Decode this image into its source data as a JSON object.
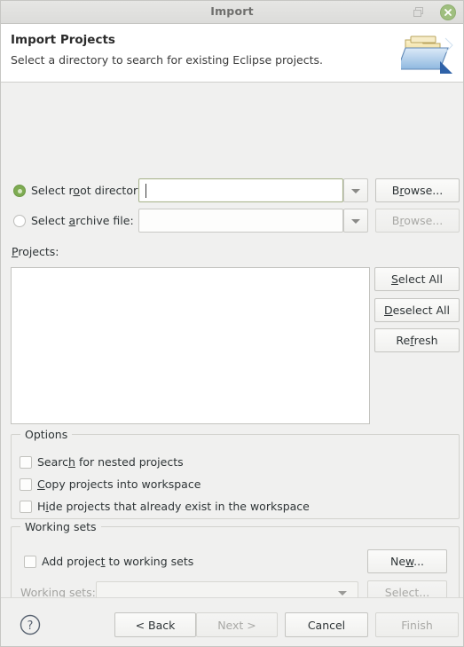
{
  "window": {
    "title": "Import",
    "restore_icon": "restore-icon",
    "close_icon": "close-icon"
  },
  "header": {
    "title": "Import Projects",
    "description": "Select a directory to search for existing Eclipse projects.",
    "icon": "open-folder-icon"
  },
  "source": {
    "root_directory": {
      "label_pre": "Select r",
      "label_mn": "o",
      "label_post": "ot directory:",
      "selected": true,
      "value": "",
      "dropdown_icon": "chevron-down-icon",
      "browse": {
        "pre": "B",
        "mn": "r",
        "post": "owse...",
        "enabled": true
      }
    },
    "archive_file": {
      "label_pre": "Select ",
      "label_mn": "a",
      "label_post": "rchive file:",
      "selected": false,
      "value": "",
      "dropdown_icon": "chevron-down-icon",
      "browse": {
        "pre": "B",
        "mn": "r",
        "post": "owse...",
        "enabled": false
      }
    }
  },
  "projects": {
    "label_pre": "",
    "label_mn": "P",
    "label_post": "rojects:",
    "items": [],
    "buttons": [
      {
        "pre": "",
        "mn": "S",
        "post": "elect All",
        "enabled": true,
        "name": "select-all-button"
      },
      {
        "pre": "",
        "mn": "D",
        "post": "eselect All",
        "enabled": true,
        "name": "deselect-all-button"
      },
      {
        "pre": "Re",
        "mn": "f",
        "post": "resh",
        "enabled": true,
        "name": "refresh-button"
      }
    ]
  },
  "options": {
    "title": "Options",
    "checkboxes": [
      {
        "pre": "Searc",
        "mn": "h",
        "post": " for nested projects",
        "checked": false,
        "name": "search-nested-projects-checkbox"
      },
      {
        "pre": "",
        "mn": "C",
        "post": "opy projects into workspace",
        "checked": false,
        "name": "copy-projects-checkbox"
      },
      {
        "pre": "H",
        "mn": "i",
        "post": "de projects that already exist in the workspace",
        "checked": false,
        "name": "hide-existing-projects-checkbox"
      }
    ]
  },
  "working_sets": {
    "title": "Working sets",
    "add_checkbox": {
      "pre": "Add projec",
      "mn": "t",
      "post": " to working sets",
      "checked": false
    },
    "new_button": {
      "pre": "Ne",
      "mn": "w",
      "post": "...",
      "enabled": true
    },
    "combo_label": {
      "pre": "W",
      "mn": "o",
      "post": "rking sets:",
      "enabled": false
    },
    "combo_value": "",
    "combo_icon": "chevron-down-icon",
    "select_button": {
      "pre": "S",
      "mn": "e",
      "post": "lect...",
      "enabled": false
    }
  },
  "footer": {
    "help_icon": "help-icon",
    "buttons": [
      {
        "label": "< Back",
        "enabled": true,
        "name": "back-button"
      },
      {
        "label": "Next >",
        "enabled": false,
        "name": "next-button"
      },
      {
        "label": "Cancel",
        "enabled": true,
        "name": "cancel-button"
      },
      {
        "label": "Finish",
        "enabled": false,
        "name": "finish-button"
      }
    ]
  },
  "colors": {
    "accent_green": "#7eab52",
    "close_green": "#9fbf7f",
    "body_bg": "#f0f0ef",
    "header_bg": "#ffffff",
    "focus_border": "#a8b38c"
  }
}
